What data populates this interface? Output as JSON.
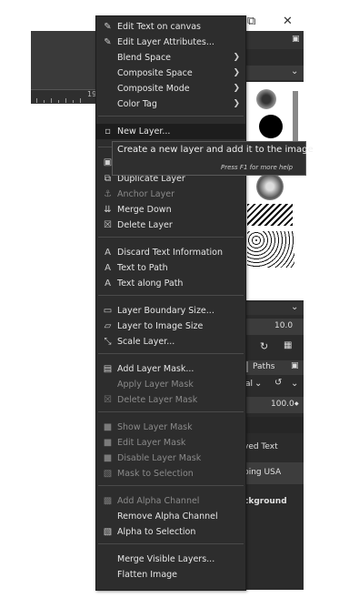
{
  "window": {
    "controls": [
      "⧉",
      "✕"
    ]
  },
  "ruler": {
    "label": "19"
  },
  "right_panel": {
    "value_1": "10.0",
    "tab_paths": "Paths",
    "mode_fragment": "al",
    "value_2": "100.0",
    "layer_1": "ved Text",
    "layer_2": "ping USA",
    "layer_3": "ckground"
  },
  "menu": {
    "items": [
      {
        "label": "Edit Text on canvas",
        "icon": "text-edit-icon",
        "glyph": "✎",
        "arrow": false,
        "disabled": false
      },
      {
        "label": "Edit Layer Attributes...",
        "icon": "layer-attributes-icon",
        "glyph": "✎",
        "arrow": false,
        "disabled": false
      },
      {
        "label": "Blend Space",
        "icon": "",
        "glyph": "",
        "arrow": true,
        "disabled": false
      },
      {
        "label": "Composite Space",
        "icon": "",
        "glyph": "",
        "arrow": true,
        "disabled": false
      },
      {
        "label": "Composite Mode",
        "icon": "",
        "glyph": "",
        "arrow": true,
        "disabled": false
      },
      {
        "label": "Color Tag",
        "icon": "",
        "glyph": "",
        "arrow": true,
        "disabled": false
      },
      {
        "label": "New Layer...",
        "icon": "new-layer-icon",
        "glyph": "▫",
        "arrow": false,
        "disabled": false,
        "highlight": true
      },
      {
        "label": "",
        "icon": "new-layer-group-icon",
        "glyph": "▣",
        "arrow": false,
        "disabled": false
      },
      {
        "label": "Duplicate Layer",
        "icon": "duplicate-layer-icon",
        "glyph": "⧉",
        "arrow": false,
        "disabled": false
      },
      {
        "label": "Anchor Layer",
        "icon": "anchor-icon",
        "glyph": "⚓",
        "arrow": false,
        "disabled": true
      },
      {
        "label": "Merge Down",
        "icon": "merge-down-icon",
        "glyph": "⇊",
        "arrow": false,
        "disabled": false
      },
      {
        "label": "Delete Layer",
        "icon": "delete-layer-icon",
        "glyph": "☒",
        "arrow": false,
        "disabled": false
      },
      {
        "label": "Discard Text Information",
        "icon": "text-a-icon",
        "glyph": "A",
        "arrow": false,
        "disabled": false
      },
      {
        "label": "Text to Path",
        "icon": "text-a-icon",
        "glyph": "A",
        "arrow": false,
        "disabled": false
      },
      {
        "label": "Text along Path",
        "icon": "text-a-icon",
        "glyph": "A",
        "arrow": false,
        "disabled": false
      },
      {
        "label": "Layer Boundary Size...",
        "icon": "boundary-size-icon",
        "glyph": "▭",
        "arrow": false,
        "disabled": false
      },
      {
        "label": "Layer to Image Size",
        "icon": "layer-to-image-icon",
        "glyph": "▱",
        "arrow": false,
        "disabled": false
      },
      {
        "label": "Scale Layer...",
        "icon": "scale-layer-icon",
        "glyph": "⤡",
        "arrow": false,
        "disabled": false
      },
      {
        "label": "Add Layer Mask...",
        "icon": "add-mask-icon",
        "glyph": "▤",
        "arrow": false,
        "disabled": false
      },
      {
        "label": "Apply Layer Mask",
        "icon": "",
        "glyph": "",
        "arrow": false,
        "disabled": true
      },
      {
        "label": "Delete Layer Mask",
        "icon": "delete-mask-icon",
        "glyph": "☒",
        "arrow": false,
        "disabled": true
      },
      {
        "label": "Show Layer Mask",
        "icon": "checkbox-icon",
        "glyph": "■",
        "arrow": false,
        "disabled": true
      },
      {
        "label": "Edit Layer Mask",
        "icon": "checkbox-icon",
        "glyph": "■",
        "arrow": false,
        "disabled": true
      },
      {
        "label": "Disable Layer Mask",
        "icon": "checkbox-icon",
        "glyph": "■",
        "arrow": false,
        "disabled": true
      },
      {
        "label": "Mask to Selection",
        "icon": "mask-selection-icon",
        "glyph": "▧",
        "arrow": false,
        "disabled": true
      },
      {
        "label": "Add Alpha Channel",
        "icon": "alpha-channel-icon",
        "glyph": "▩",
        "arrow": false,
        "disabled": true
      },
      {
        "label": "Remove Alpha Channel",
        "icon": "",
        "glyph": "",
        "arrow": false,
        "disabled": false
      },
      {
        "label": "Alpha to Selection",
        "icon": "alpha-selection-icon",
        "glyph": "▧",
        "arrow": false,
        "disabled": false
      },
      {
        "label": "Merge Visible Layers...",
        "icon": "",
        "glyph": "",
        "arrow": false,
        "disabled": false
      },
      {
        "label": "Flatten Image",
        "icon": "",
        "glyph": "",
        "arrow": false,
        "disabled": false
      }
    ]
  },
  "tooltip": {
    "text": "Create a new layer and add it to the image",
    "hint": "Press F1 for more help"
  }
}
